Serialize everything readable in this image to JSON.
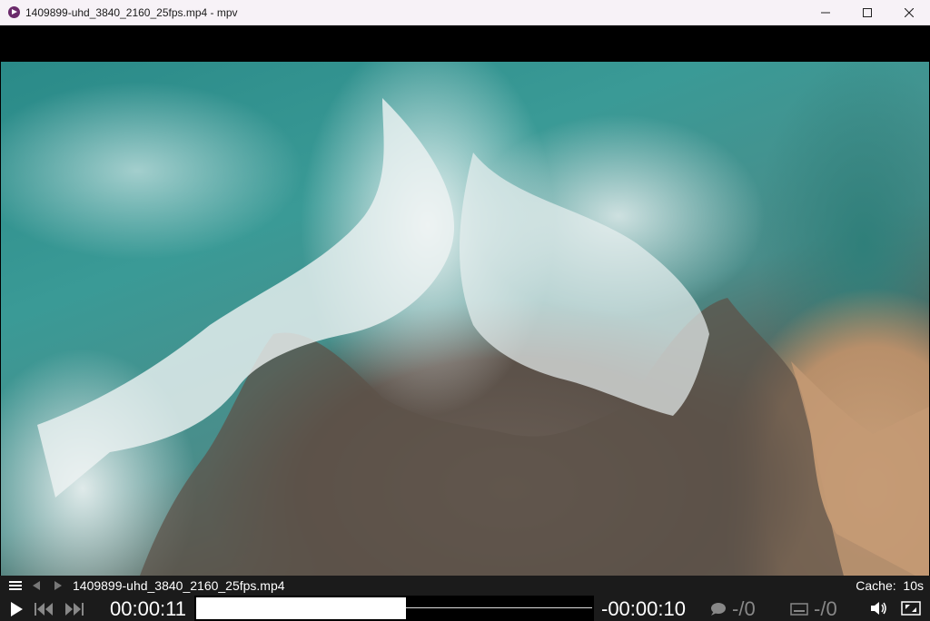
{
  "window": {
    "title": "1409899-uhd_3840_2160_25fps.mp4 - mpv",
    "icons": {
      "app": "mpv-icon",
      "minimize": "minimize-icon",
      "maximize": "maximize-icon",
      "close": "close-icon"
    }
  },
  "video": {
    "description_colors": {
      "sea": "#2a8a88",
      "foam": "#f0f4f4",
      "rock": "#5a5048",
      "sand": "#c9a07a"
    }
  },
  "osc": {
    "filename": "1409899-uhd_3840_2160_25fps.mp4",
    "cache_label": "Cache:",
    "cache_value": "10s",
    "time_current": "00:00:11",
    "time_remaining": "-00:00:10",
    "progress_fraction": 0.53,
    "audio_track": "-/0",
    "subtitle_track": "-/0",
    "icons": {
      "menu": "menu-icon",
      "playlist_prev": "playlist-prev-icon",
      "playlist_next": "playlist-next-icon",
      "play": "play-icon",
      "skip_back": "skip-back-icon",
      "skip_forward": "skip-forward-icon",
      "audio": "speech-bubble-icon",
      "subtitle": "subtitle-icon",
      "volume": "volume-icon",
      "fullscreen": "fullscreen-icon"
    },
    "colors": {
      "bar_bg": "#1b1b1b",
      "text": "#ffffff",
      "dim_text": "#888888"
    }
  }
}
